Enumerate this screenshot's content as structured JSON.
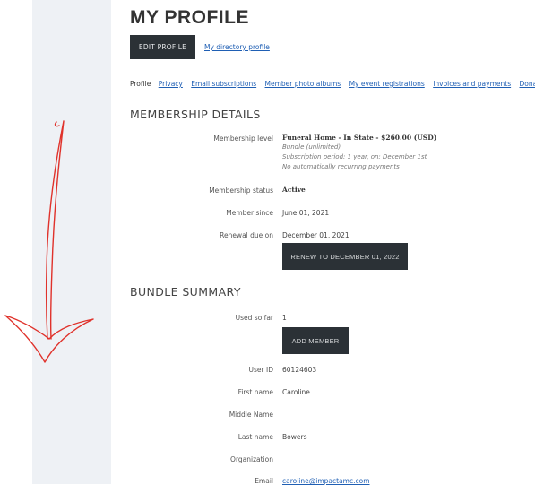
{
  "page": {
    "title": "MY PROFILE",
    "edit_button": "EDIT PROFILE",
    "directory_link": "My directory profile"
  },
  "tabs": [
    {
      "label": "Profile",
      "active": true
    },
    {
      "label": "Privacy"
    },
    {
      "label": "Email subscriptions"
    },
    {
      "label": "Member photo albums"
    },
    {
      "label": "My event registrations"
    },
    {
      "label": "Invoices and payments"
    },
    {
      "label": "Donations"
    }
  ],
  "membership": {
    "heading": "MEMBERSHIP DETAILS",
    "level_label": "Membership level",
    "level_value": "Funeral Home - In State - $260.00 (USD)",
    "level_sub1": "Bundle (unlimited)",
    "level_sub2": "Subscription period: 1 year, on: December 1st",
    "level_sub3": "No automatically recurring payments",
    "status_label": "Membership status",
    "status_value": "Active",
    "since_label": "Member since",
    "since_value": "June 01, 2021",
    "renewal_label": "Renewal due on",
    "renewal_value": "December 01, 2021",
    "renew_button": "RENEW TO DECEMBER 01, 2022"
  },
  "bundle": {
    "heading": "BUNDLE SUMMARY",
    "used_label": "Used so far",
    "used_value": "1",
    "add_button": "ADD MEMBER"
  },
  "profile": {
    "userid_label": "User ID",
    "userid_value": "60124603",
    "first_label": "First name",
    "first_value": "Caroline",
    "middle_label": "Middle Name",
    "middle_value": "",
    "last_label": "Last name",
    "last_value": "Bowers",
    "org_label": "Organization",
    "org_value": "",
    "email_label": "Email",
    "email_value": "caroline@impactamc.com"
  },
  "colors": {
    "button_bg": "#2b3136",
    "link": "#1f5fb4",
    "sidebar": "#eef1f5",
    "annotation_arrow": "#e0322b"
  }
}
